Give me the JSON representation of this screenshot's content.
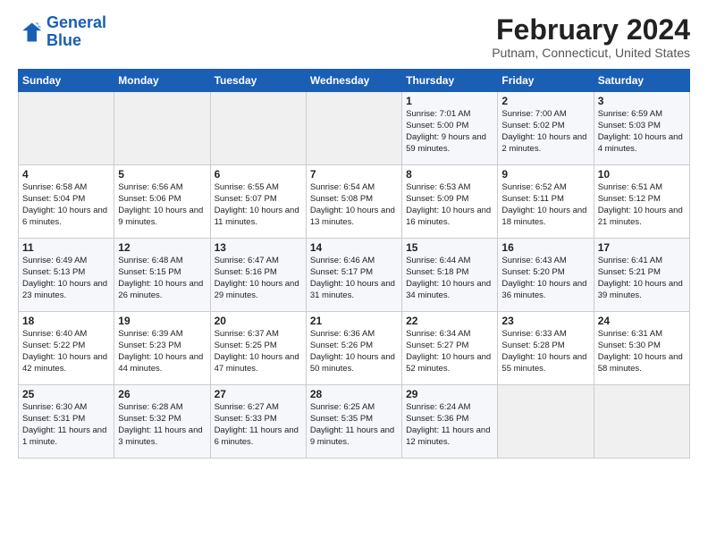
{
  "app": {
    "name": "GeneralBlue",
    "logo_line1": "General",
    "logo_line2": "Blue"
  },
  "title": "February 2024",
  "location": "Putnam, Connecticut, United States",
  "days_of_week": [
    "Sunday",
    "Monday",
    "Tuesday",
    "Wednesday",
    "Thursday",
    "Friday",
    "Saturday"
  ],
  "weeks": [
    [
      {
        "day": "",
        "info": ""
      },
      {
        "day": "",
        "info": ""
      },
      {
        "day": "",
        "info": ""
      },
      {
        "day": "",
        "info": ""
      },
      {
        "day": "1",
        "info": "Sunrise: 7:01 AM\nSunset: 5:00 PM\nDaylight: 9 hours and 59 minutes."
      },
      {
        "day": "2",
        "info": "Sunrise: 7:00 AM\nSunset: 5:02 PM\nDaylight: 10 hours and 2 minutes."
      },
      {
        "day": "3",
        "info": "Sunrise: 6:59 AM\nSunset: 5:03 PM\nDaylight: 10 hours and 4 minutes."
      }
    ],
    [
      {
        "day": "4",
        "info": "Sunrise: 6:58 AM\nSunset: 5:04 PM\nDaylight: 10 hours and 6 minutes."
      },
      {
        "day": "5",
        "info": "Sunrise: 6:56 AM\nSunset: 5:06 PM\nDaylight: 10 hours and 9 minutes."
      },
      {
        "day": "6",
        "info": "Sunrise: 6:55 AM\nSunset: 5:07 PM\nDaylight: 10 hours and 11 minutes."
      },
      {
        "day": "7",
        "info": "Sunrise: 6:54 AM\nSunset: 5:08 PM\nDaylight: 10 hours and 13 minutes."
      },
      {
        "day": "8",
        "info": "Sunrise: 6:53 AM\nSunset: 5:09 PM\nDaylight: 10 hours and 16 minutes."
      },
      {
        "day": "9",
        "info": "Sunrise: 6:52 AM\nSunset: 5:11 PM\nDaylight: 10 hours and 18 minutes."
      },
      {
        "day": "10",
        "info": "Sunrise: 6:51 AM\nSunset: 5:12 PM\nDaylight: 10 hours and 21 minutes."
      }
    ],
    [
      {
        "day": "11",
        "info": "Sunrise: 6:49 AM\nSunset: 5:13 PM\nDaylight: 10 hours and 23 minutes."
      },
      {
        "day": "12",
        "info": "Sunrise: 6:48 AM\nSunset: 5:15 PM\nDaylight: 10 hours and 26 minutes."
      },
      {
        "day": "13",
        "info": "Sunrise: 6:47 AM\nSunset: 5:16 PM\nDaylight: 10 hours and 29 minutes."
      },
      {
        "day": "14",
        "info": "Sunrise: 6:46 AM\nSunset: 5:17 PM\nDaylight: 10 hours and 31 minutes."
      },
      {
        "day": "15",
        "info": "Sunrise: 6:44 AM\nSunset: 5:18 PM\nDaylight: 10 hours and 34 minutes."
      },
      {
        "day": "16",
        "info": "Sunrise: 6:43 AM\nSunset: 5:20 PM\nDaylight: 10 hours and 36 minutes."
      },
      {
        "day": "17",
        "info": "Sunrise: 6:41 AM\nSunset: 5:21 PM\nDaylight: 10 hours and 39 minutes."
      }
    ],
    [
      {
        "day": "18",
        "info": "Sunrise: 6:40 AM\nSunset: 5:22 PM\nDaylight: 10 hours and 42 minutes."
      },
      {
        "day": "19",
        "info": "Sunrise: 6:39 AM\nSunset: 5:23 PM\nDaylight: 10 hours and 44 minutes."
      },
      {
        "day": "20",
        "info": "Sunrise: 6:37 AM\nSunset: 5:25 PM\nDaylight: 10 hours and 47 minutes."
      },
      {
        "day": "21",
        "info": "Sunrise: 6:36 AM\nSunset: 5:26 PM\nDaylight: 10 hours and 50 minutes."
      },
      {
        "day": "22",
        "info": "Sunrise: 6:34 AM\nSunset: 5:27 PM\nDaylight: 10 hours and 52 minutes."
      },
      {
        "day": "23",
        "info": "Sunrise: 6:33 AM\nSunset: 5:28 PM\nDaylight: 10 hours and 55 minutes."
      },
      {
        "day": "24",
        "info": "Sunrise: 6:31 AM\nSunset: 5:30 PM\nDaylight: 10 hours and 58 minutes."
      }
    ],
    [
      {
        "day": "25",
        "info": "Sunrise: 6:30 AM\nSunset: 5:31 PM\nDaylight: 11 hours and 1 minute."
      },
      {
        "day": "26",
        "info": "Sunrise: 6:28 AM\nSunset: 5:32 PM\nDaylight: 11 hours and 3 minutes."
      },
      {
        "day": "27",
        "info": "Sunrise: 6:27 AM\nSunset: 5:33 PM\nDaylight: 11 hours and 6 minutes."
      },
      {
        "day": "28",
        "info": "Sunrise: 6:25 AM\nSunset: 5:35 PM\nDaylight: 11 hours and 9 minutes."
      },
      {
        "day": "29",
        "info": "Sunrise: 6:24 AM\nSunset: 5:36 PM\nDaylight: 11 hours and 12 minutes."
      },
      {
        "day": "",
        "info": ""
      },
      {
        "day": "",
        "info": ""
      }
    ]
  ]
}
